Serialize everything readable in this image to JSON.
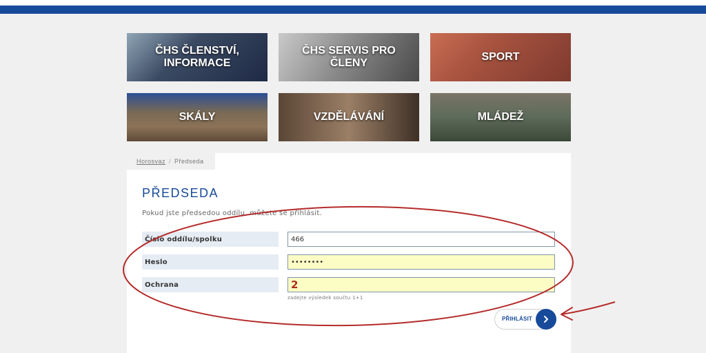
{
  "tiles": [
    {
      "label": "ČHS ČLENSTVÍ, INFORMACE"
    },
    {
      "label": "ČHS SERVIS PRO ČLENY"
    },
    {
      "label": "SPORT"
    },
    {
      "label": "SKÁLY"
    },
    {
      "label": "VZDĚLÁVÁNÍ"
    },
    {
      "label": "MLÁDEŽ"
    }
  ],
  "breadcrumb": {
    "home": "Horosvaz",
    "separator": "/",
    "current": "Předseda"
  },
  "page": {
    "title": "PŘEDSEDA",
    "intro": "Pokud jste předsedou oddílu, můžete se přihlásit."
  },
  "form": {
    "club_number_label": "Číslo oddílu/spolku",
    "club_number_value": "466",
    "password_label": "Heslo",
    "password_value": "••••••••",
    "captcha_label": "Ochrana",
    "captcha_value": "2",
    "captcha_hint": "zadejte výsledek součtu 1+1",
    "submit_label": "PŘIHLÁSIT",
    "submit_icon": "chevron-right-icon"
  },
  "colors": {
    "brand_blue": "#174a9a",
    "field_yellow": "#fcfdc5",
    "annotation_red": "#b52a2a"
  }
}
